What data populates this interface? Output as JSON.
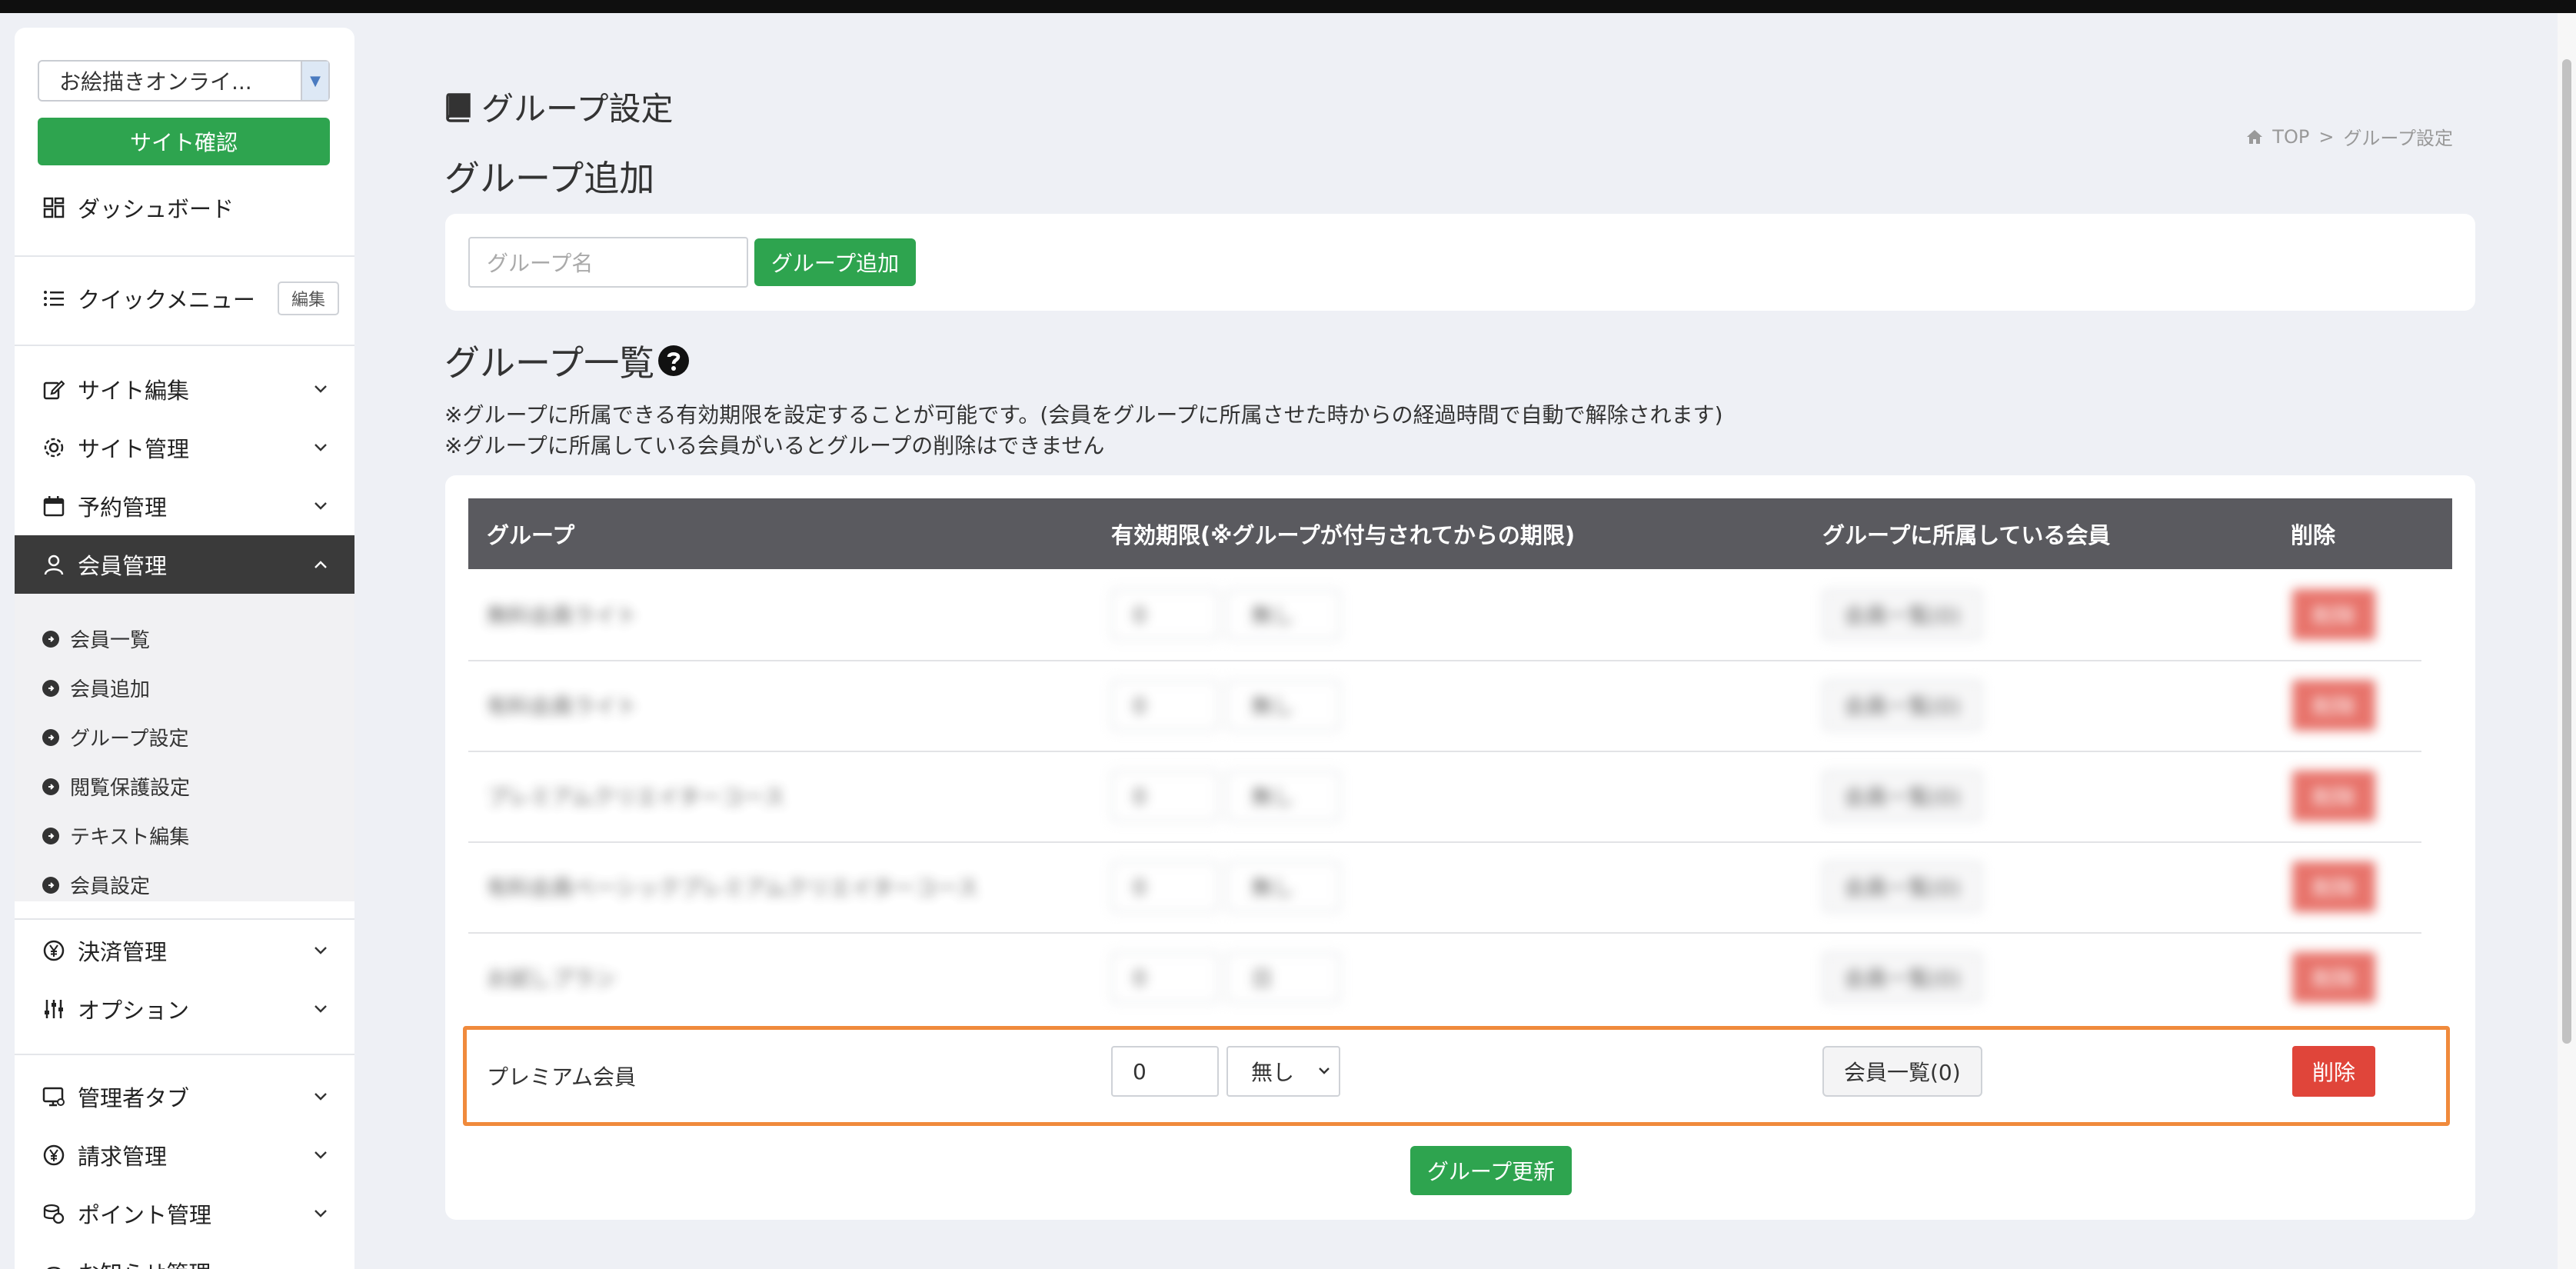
{
  "sidebar": {
    "site_select": "お絵描きオンライ...",
    "site_check": "サイト確認",
    "dashboard": "ダッシュボード",
    "quick_menu": "クイックメニュー",
    "quick_menu_edit": "編集",
    "menu": {
      "site_edit": "サイト編集",
      "site_manage": "サイト管理",
      "reservation": "予約管理",
      "member_manage": "会員管理",
      "payment": "決済管理",
      "option": "オプション",
      "admin_tab": "管理者タブ",
      "billing": "請求管理",
      "points": "ポイント管理",
      "notice": "お知らせ管理"
    },
    "member_sub": [
      "会員一覧",
      "会員追加",
      "グループ設定",
      "閲覧保護設定",
      "テキスト編集",
      "会員設定"
    ]
  },
  "page": {
    "title": "グループ設定",
    "breadcrumb_home": "TOP",
    "breadcrumb_sep": ">",
    "breadcrumb_current": "グループ設定",
    "add_heading": "グループ追加",
    "group_name_placeholder": "グループ名",
    "add_button": "グループ追加",
    "list_heading": "グループ一覧",
    "note1": "※グループに所属できる有効期限を設定することが可能です。(会員をグループに所属させた時からの経過時間で自動で解除されます)",
    "note2": "※グループに所属している会員がいるとグループの削除はできません",
    "update_button": "グループ更新"
  },
  "table": {
    "headers": [
      "グループ",
      "有効期限(※グループが付与されてからの期限)",
      "グループに所属している会員",
      "削除"
    ],
    "blurred_rows": [
      {
        "name": "無料会員ライト",
        "period": "0",
        "unit": "無し",
        "members": "会員一覧(0)",
        "delete": "削除"
      },
      {
        "name": "有料会員ライト",
        "period": "0",
        "unit": "無し",
        "members": "会員一覧(0)",
        "delete": "削除"
      },
      {
        "name": "プレミアムクリエイターコース",
        "period": "0",
        "unit": "無し",
        "members": "会員一覧(0)",
        "delete": "削除"
      },
      {
        "name": "有料会員ベーシックプレミアムクリエイターコース",
        "period": "0",
        "unit": "無し",
        "members": "会員一覧(0)",
        "delete": "削除"
      },
      {
        "name": "お試しプラン",
        "period": "0",
        "unit": "日",
        "members": "会員一覧(0)",
        "delete": "削除"
      }
    ],
    "highlight_row": {
      "name": "プレミアム会員",
      "period": "0",
      "unit": "無し",
      "members": "会員一覧(0)",
      "delete": "削除"
    }
  },
  "colors": {
    "accent_green": "#2ea44f",
    "delete_red": "#e0453a",
    "highlight_orange": "#f08a3c",
    "header_gray": "#5a5a5f"
  }
}
